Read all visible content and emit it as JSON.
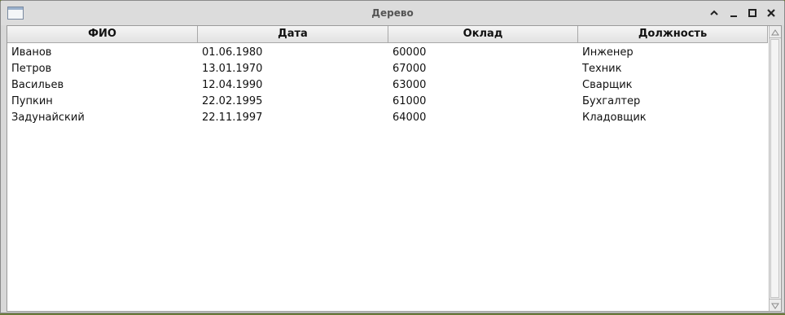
{
  "window": {
    "title": "Дерево"
  },
  "table": {
    "columns": [
      "ФИО",
      "Дата",
      "Оклад",
      "Должность"
    ],
    "rows": [
      [
        "Иванов",
        "01.06.1980",
        "60000",
        "Инженер"
      ],
      [
        "Петров",
        "13.01.1970",
        "67000",
        "Техник"
      ],
      [
        "Васильев",
        "12.04.1990",
        "63000",
        "Сварщик"
      ],
      [
        "Пупкин",
        "22.02.1995",
        "61000",
        "Бухгалтер"
      ],
      [
        "Задунайский",
        "22.11.1997",
        "64000",
        "Кладовщик"
      ]
    ]
  },
  "icons": {
    "app": "window-icon",
    "shade": "chevron-up-icon",
    "minimize": "minimize-icon",
    "maximize": "maximize-icon",
    "close": "close-icon",
    "scroll_up": "arrow-up-icon",
    "scroll_down": "arrow-down-icon"
  }
}
